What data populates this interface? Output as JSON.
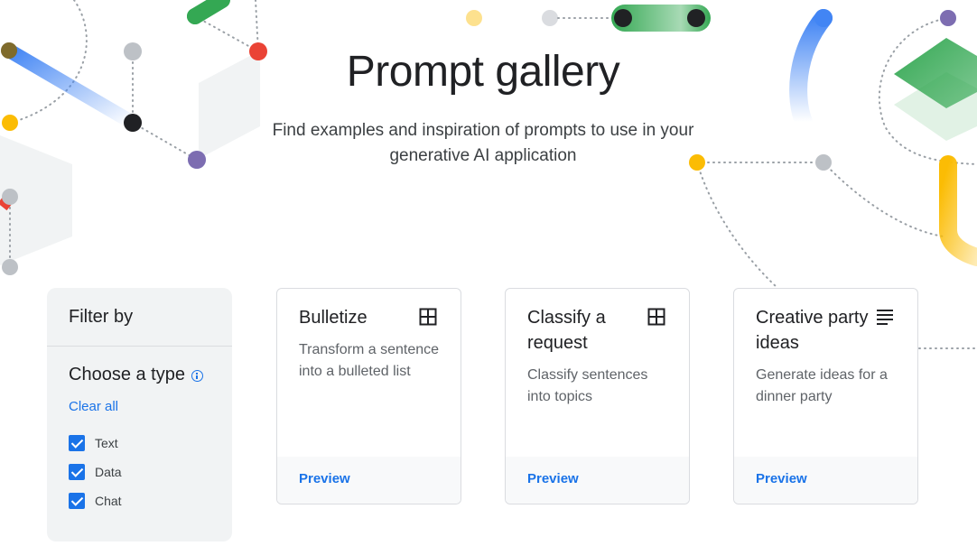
{
  "hero": {
    "title": "Prompt gallery",
    "subtitle": "Find examples and inspiration of prompts to use in your generative AI application"
  },
  "filter": {
    "heading": "Filter by",
    "type_heading": "Choose a type",
    "clear_all": "Clear all",
    "options": [
      {
        "label": "Text",
        "checked": true
      },
      {
        "label": "Data",
        "checked": true
      },
      {
        "label": "Chat",
        "checked": true
      }
    ]
  },
  "cards": [
    {
      "title": "Bulletize",
      "description": "Transform a sentence into a bulleted list",
      "icon": "table-grid-icon",
      "action": "Preview"
    },
    {
      "title": "Classify a request",
      "description": "Classify sentences into topics",
      "icon": "table-grid-icon",
      "action": "Preview"
    },
    {
      "title": "Creative party ideas",
      "description": "Generate ideas for a dinner party",
      "icon": "text-lines-icon",
      "action": "Preview"
    }
  ],
  "colors": {
    "accent": "#1a73e8",
    "google_blue": "#4285f4",
    "google_red": "#ea4335",
    "google_yellow": "#fbbc04",
    "google_green": "#34a853",
    "panel_bg": "#f1f3f4"
  }
}
